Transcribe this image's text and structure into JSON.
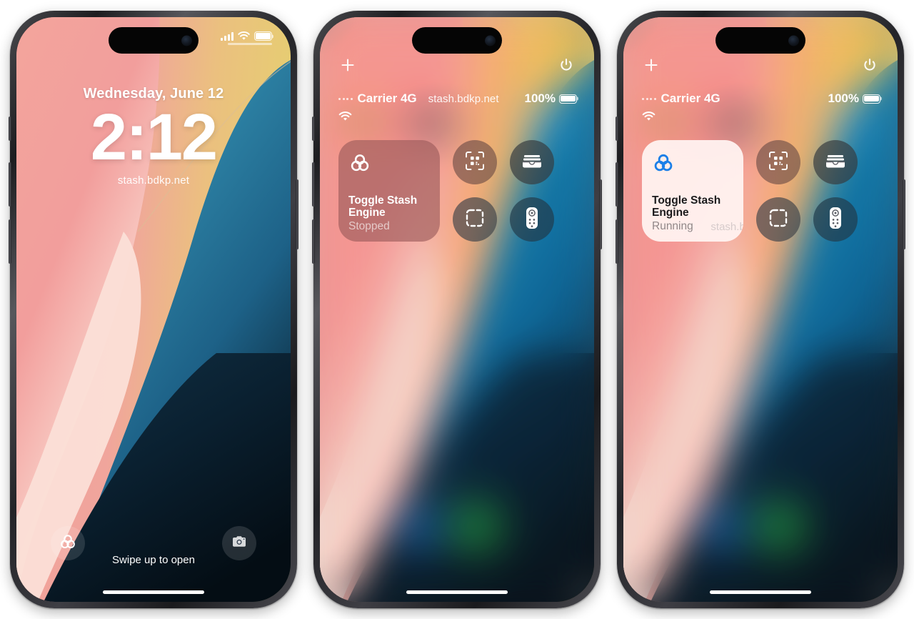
{
  "meta": {
    "accent_blue": "#1b7fe8",
    "widget_stopped_bg": "#8f5757",
    "widget_running_bg": "#fdf2f0",
    "wallpaper": {
      "pink_top": "#f4a39c",
      "pink_mid": "#f59b9b",
      "cream": "#fbdcd4",
      "yellow": "#e9cf7e",
      "teal": "#2b7f9e",
      "blue_deep": "#1b5f83",
      "navy": "#0c2231",
      "black_navy": "#06131c"
    }
  },
  "phones": [
    {
      "id": "lock-screen",
      "screen": "lock",
      "status_bar": {
        "signal_icon": "cellular-bars-icon",
        "wifi_icon": "wifi-icon",
        "battery_icon": "battery-full-icon"
      },
      "date": "Wednesday, June 12",
      "time": "2:12",
      "hostname": "stash.bdkp.net",
      "shortcut_left_icon": "stash-trefoil-icon",
      "shortcut_right_icon": "camera-icon",
      "swipe_hint": "Swipe up to open"
    },
    {
      "id": "control-center-stopped",
      "screen": "control-center",
      "top_left_icon": "plus-icon",
      "top_right_icon": "power-icon",
      "status": {
        "carrier": "Carrier 4G",
        "hostname": "stash.bdkp.net",
        "battery_percent": "100%",
        "wifi_icon": "wifi-icon",
        "battery_icon": "battery-full-icon",
        "signal_dots_icon": "cellular-dots-icon"
      },
      "widget": {
        "icon": "stash-trefoil-icon",
        "title_line1": "Toggle Stash",
        "title_line2": "Engine",
        "state": "Stopped",
        "ghost_hostname": ""
      },
      "controls": [
        {
          "icon": "qr-code-scanner-icon",
          "name": "code-scanner-button"
        },
        {
          "icon": "wallet-icon",
          "name": "wallet-button"
        },
        {
          "icon": "screen-capture-icon",
          "name": "screen-capture-button"
        },
        {
          "icon": "apple-tv-remote-icon",
          "name": "apple-tv-remote-button"
        }
      ]
    },
    {
      "id": "control-center-running",
      "screen": "control-center",
      "top_left_icon": "plus-icon",
      "top_right_icon": "power-icon",
      "status": {
        "carrier": "Carrier 4G",
        "hostname": "",
        "battery_percent": "100%",
        "wifi_icon": "wifi-icon",
        "battery_icon": "battery-full-icon",
        "signal_dots_icon": "cellular-dots-icon"
      },
      "widget": {
        "icon": "stash-trefoil-icon",
        "title_line1": "Toggle Stash",
        "title_line2": "Engine",
        "state": "Running",
        "ghost_hostname": "stash.bdkp.net"
      },
      "controls": [
        {
          "icon": "qr-code-scanner-icon",
          "name": "code-scanner-button"
        },
        {
          "icon": "wallet-icon",
          "name": "wallet-button"
        },
        {
          "icon": "screen-capture-icon",
          "name": "screen-capture-button"
        },
        {
          "icon": "apple-tv-remote-icon",
          "name": "apple-tv-remote-button"
        }
      ]
    }
  ]
}
